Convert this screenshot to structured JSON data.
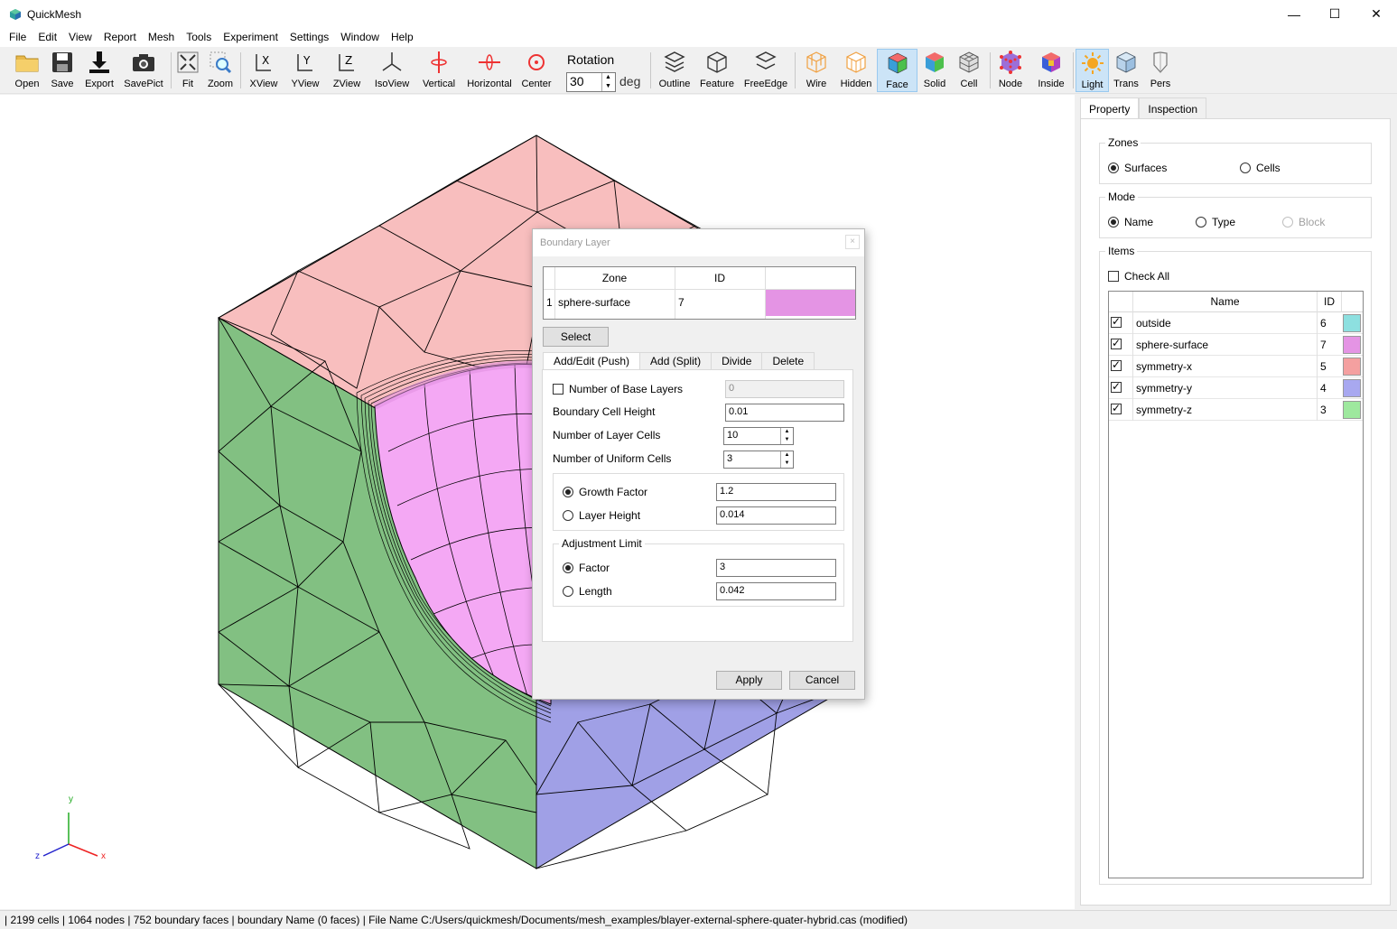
{
  "window": {
    "title": "QuickMesh",
    "minimize": "—",
    "maximize": "☐",
    "close": "✕"
  },
  "menu": [
    "File",
    "Edit",
    "View",
    "Report",
    "Mesh",
    "Tools",
    "Experiment",
    "Settings",
    "Window",
    "Help"
  ],
  "toolbar": {
    "open": "Open",
    "save": "Save",
    "export": "Export",
    "savepict": "SavePict",
    "fit": "Fit",
    "zoom": "Zoom",
    "xview": "XView",
    "yview": "YView",
    "zview": "ZView",
    "isoview": "IsoView",
    "vertical": "Vertical",
    "horizontal": "Horizontal",
    "center": "Center",
    "rotation_label": "Rotation",
    "rotation_value": "30",
    "rotation_unit": "deg",
    "outline": "Outline",
    "feature": "Feature",
    "freeedge": "FreeEdge",
    "wire": "Wire",
    "hidden": "Hidden",
    "face": "Face",
    "solid": "Solid",
    "cell": "Cell",
    "node": "Node",
    "inside": "Inside",
    "light": "Light",
    "trans": "Trans",
    "pers": "Pers"
  },
  "axes": {
    "x": "x",
    "y": "y",
    "z": "z"
  },
  "panel": {
    "tabs": {
      "property": "Property",
      "inspection": "Inspection"
    },
    "zones": {
      "label": "Zones",
      "surfaces": "Surfaces",
      "cells": "Cells"
    },
    "mode": {
      "label": "Mode",
      "name": "Name",
      "type": "Type",
      "block": "Block"
    },
    "items": {
      "label": "Items",
      "check_all": "Check All",
      "col_name": "Name",
      "col_id": "ID",
      "rows": [
        {
          "name": "outside",
          "id": "6",
          "color": "#8de0e0"
        },
        {
          "name": "sphere-surface",
          "id": "7",
          "color": "#e494e4"
        },
        {
          "name": "symmetry-x",
          "id": "5",
          "color": "#f4a0a0"
        },
        {
          "name": "symmetry-y",
          "id": "4",
          "color": "#a8a8f0"
        },
        {
          "name": "symmetry-z",
          "id": "3",
          "color": "#9ee89e"
        }
      ]
    }
  },
  "dialog": {
    "title": "Boundary Layer",
    "close": "×",
    "table": {
      "col_zone": "Zone",
      "col_id": "ID",
      "row_index": "1",
      "zone": "sphere-surface",
      "id": "7",
      "color": "#e494e4"
    },
    "select_button": "Select",
    "tabs": {
      "add_edit": "Add/Edit (Push)",
      "add_split": "Add (Split)",
      "divide": "Divide",
      "delete": "Delete"
    },
    "fields": {
      "base_layers_label": "Number of Base Layers",
      "base_layers_value": "0",
      "cell_height_label": "Boundary Cell Height",
      "cell_height_value": "0.01",
      "layer_cells_label": "Number of Layer Cells",
      "layer_cells_value": "10",
      "uniform_cells_label": "Number of Uniform Cells",
      "uniform_cells_value": "3",
      "growth_factor_label": "Growth Factor",
      "growth_factor_value": "1.2",
      "layer_height_label": "Layer Height",
      "layer_height_value": "0.014",
      "adjustment_label": "Adjustment Limit",
      "factor_label": "Factor",
      "factor_value": "3",
      "length_label": "Length",
      "length_value": "0.042"
    },
    "apply": "Apply",
    "cancel": "Cancel"
  },
  "status": "| 2199 cells | 1064 nodes | 752 boundary faces |  boundary Name  (0 faces) | File Name C:/Users/quickmesh/Documents/mesh_examples/blayer-external-sphere-quater-hybrid.cas (modified)",
  "colors": {
    "pink_face": "#f8bebe",
    "green_face": "#82c082",
    "blue_face": "#a0a0e6",
    "sphere": "#f4a8f4",
    "accent": "#cce4f7"
  }
}
